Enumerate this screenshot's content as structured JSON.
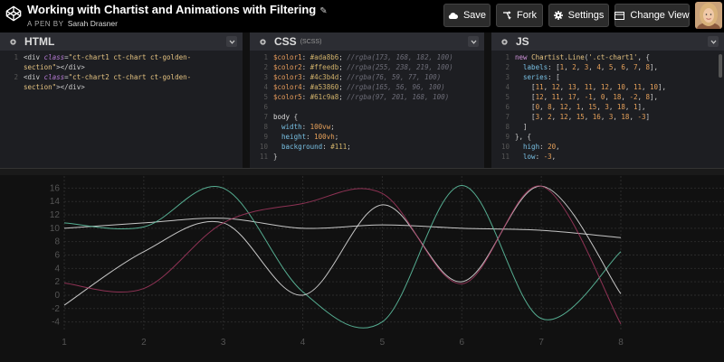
{
  "header": {
    "title": "Working with Chartist and Animations with Filtering",
    "pen_label": "A PEN BY",
    "author": "Sarah Drasner",
    "buttons": {
      "save": "Save",
      "fork": "Fork",
      "settings": "Settings",
      "change_view": "Change View"
    }
  },
  "panels": {
    "html": {
      "name": "HTML",
      "lines": [
        {
          "n": "1",
          "parts": [
            [
              "t-tag",
              "<div "
            ],
            [
              "t-attr",
              "class"
            ],
            [
              "t-tag",
              "="
            ],
            [
              "t-str",
              "\"ct-chart1 ct-chart ct-golden-"
            ]
          ]
        },
        {
          "n": "",
          "parts": [
            [
              "t-str",
              "section\""
            ],
            [
              "t-tag",
              "></div>"
            ]
          ]
        },
        {
          "n": "2",
          "parts": [
            [
              "t-tag",
              "<div "
            ],
            [
              "t-attr",
              "class"
            ],
            [
              "t-tag",
              "="
            ],
            [
              "t-str",
              "\"ct-chart2 ct-chart ct-golden-"
            ]
          ]
        },
        {
          "n": "",
          "parts": [
            [
              "t-str",
              "section\""
            ],
            [
              "t-tag",
              "></div>"
            ]
          ]
        }
      ]
    },
    "css": {
      "name": "CSS",
      "sub": "(SCSS)",
      "lines": [
        {
          "n": "1",
          "parts": [
            [
              "t-var",
              "$color1"
            ],
            [
              "t-plain",
              ": "
            ],
            [
              "t-val",
              "#ada8b6"
            ],
            [
              "t-plain",
              "; "
            ],
            [
              "t-com",
              "//rgba(173, 168, 182, 100)"
            ]
          ]
        },
        {
          "n": "2",
          "parts": [
            [
              "t-var",
              "$color2"
            ],
            [
              "t-plain",
              ": "
            ],
            [
              "t-val",
              "#ffeedb"
            ],
            [
              "t-plain",
              "; "
            ],
            [
              "t-com",
              "//rgba(255, 238, 219, 100)"
            ]
          ]
        },
        {
          "n": "3",
          "parts": [
            [
              "t-var",
              "$color3"
            ],
            [
              "t-plain",
              ": "
            ],
            [
              "t-val",
              "#4c3b4d"
            ],
            [
              "t-plain",
              "; "
            ],
            [
              "t-com",
              "//rgba(76, 59, 77, 100)"
            ]
          ]
        },
        {
          "n": "4",
          "parts": [
            [
              "t-var",
              "$color4"
            ],
            [
              "t-plain",
              ": "
            ],
            [
              "t-val",
              "#a53860"
            ],
            [
              "t-plain",
              "; "
            ],
            [
              "t-com",
              "//rgba(165, 56, 96, 100)"
            ]
          ]
        },
        {
          "n": "5",
          "parts": [
            [
              "t-var",
              "$color5"
            ],
            [
              "t-plain",
              ": "
            ],
            [
              "t-val",
              "#61c9a8"
            ],
            [
              "t-plain",
              "; "
            ],
            [
              "t-com",
              "//rgba(97, 201, 168, 100)"
            ]
          ]
        },
        {
          "n": "6",
          "parts": [
            [
              "t-plain",
              ""
            ]
          ]
        },
        {
          "n": "7",
          "parts": [
            [
              "t-sel",
              "body"
            ],
            [
              "t-plain",
              " {"
            ]
          ]
        },
        {
          "n": "8",
          "parts": [
            [
              "t-plain",
              "  "
            ],
            [
              "t-prop",
              "width"
            ],
            [
              "t-plain",
              ": "
            ],
            [
              "t-num",
              "100vw"
            ],
            [
              "t-plain",
              ";"
            ]
          ]
        },
        {
          "n": "9",
          "parts": [
            [
              "t-plain",
              "  "
            ],
            [
              "t-prop",
              "height"
            ],
            [
              "t-plain",
              ": "
            ],
            [
              "t-num",
              "100vh"
            ],
            [
              "t-plain",
              ";"
            ]
          ]
        },
        {
          "n": "10",
          "parts": [
            [
              "t-plain",
              "  "
            ],
            [
              "t-prop",
              "background"
            ],
            [
              "t-plain",
              ": "
            ],
            [
              "t-val",
              "#111"
            ],
            [
              "t-plain",
              ";"
            ]
          ]
        },
        {
          "n": "11",
          "parts": [
            [
              "t-plain",
              "}"
            ]
          ]
        }
      ]
    },
    "js": {
      "name": "JS",
      "lines": [
        {
          "n": "1",
          "parts": [
            [
              "t-kw",
              "new "
            ],
            [
              "t-fn",
              "Chartist"
            ],
            [
              "t-plain",
              "."
            ],
            [
              "t-fn",
              "Line"
            ],
            [
              "t-plain",
              "("
            ],
            [
              "t-str",
              "'.ct-chart1'"
            ],
            [
              "t-plain",
              ", {"
            ]
          ]
        },
        {
          "n": "2",
          "parts": [
            [
              "t-plain",
              "  "
            ],
            [
              "t-prop",
              "labels"
            ],
            [
              "t-plain",
              ": ["
            ],
            [
              "t-num",
              "1"
            ],
            [
              "t-plain",
              ", "
            ],
            [
              "t-num",
              "2"
            ],
            [
              "t-plain",
              ", "
            ],
            [
              "t-num",
              "3"
            ],
            [
              "t-plain",
              ", "
            ],
            [
              "t-num",
              "4"
            ],
            [
              "t-plain",
              ", "
            ],
            [
              "t-num",
              "5"
            ],
            [
              "t-plain",
              ", "
            ],
            [
              "t-num",
              "6"
            ],
            [
              "t-plain",
              ", "
            ],
            [
              "t-num",
              "7"
            ],
            [
              "t-plain",
              ", "
            ],
            [
              "t-num",
              "8"
            ],
            [
              "t-plain",
              "],"
            ]
          ]
        },
        {
          "n": "3",
          "parts": [
            [
              "t-plain",
              "  "
            ],
            [
              "t-prop",
              "series"
            ],
            [
              "t-plain",
              ": ["
            ]
          ]
        },
        {
          "n": "4",
          "parts": [
            [
              "t-plain",
              "    ["
            ],
            [
              "t-num",
              "11"
            ],
            [
              "t-plain",
              ", "
            ],
            [
              "t-num",
              "12"
            ],
            [
              "t-plain",
              ", "
            ],
            [
              "t-num",
              "13"
            ],
            [
              "t-plain",
              ", "
            ],
            [
              "t-num",
              "11"
            ],
            [
              "t-plain",
              ", "
            ],
            [
              "t-num",
              "12"
            ],
            [
              "t-plain",
              ", "
            ],
            [
              "t-num",
              "10"
            ],
            [
              "t-plain",
              ", "
            ],
            [
              "t-num",
              "11"
            ],
            [
              "t-plain",
              ", "
            ],
            [
              "t-num",
              "10"
            ],
            [
              "t-plain",
              "],"
            ]
          ]
        },
        {
          "n": "5",
          "parts": [
            [
              "t-plain",
              "    ["
            ],
            [
              "t-num",
              "12"
            ],
            [
              "t-plain",
              ", "
            ],
            [
              "t-num",
              "11"
            ],
            [
              "t-plain",
              ", "
            ],
            [
              "t-num",
              "17"
            ],
            [
              "t-plain",
              ", "
            ],
            [
              "t-num",
              "-1"
            ],
            [
              "t-plain",
              ", "
            ],
            [
              "t-num",
              "0"
            ],
            [
              "t-plain",
              ", "
            ],
            [
              "t-num",
              "18"
            ],
            [
              "t-plain",
              ", "
            ],
            [
              "t-num",
              "-2"
            ],
            [
              "t-plain",
              ", "
            ],
            [
              "t-num",
              "8"
            ],
            [
              "t-plain",
              "],"
            ]
          ]
        },
        {
          "n": "6",
          "parts": [
            [
              "t-plain",
              "    ["
            ],
            [
              "t-num",
              "0"
            ],
            [
              "t-plain",
              ", "
            ],
            [
              "t-num",
              "8"
            ],
            [
              "t-plain",
              ", "
            ],
            [
              "t-num",
              "12"
            ],
            [
              "t-plain",
              ", "
            ],
            [
              "t-num",
              "1"
            ],
            [
              "t-plain",
              ", "
            ],
            [
              "t-num",
              "15"
            ],
            [
              "t-plain",
              ", "
            ],
            [
              "t-num",
              "3"
            ],
            [
              "t-plain",
              ", "
            ],
            [
              "t-num",
              "18"
            ],
            [
              "t-plain",
              ", "
            ],
            [
              "t-num",
              "1"
            ],
            [
              "t-plain",
              "],"
            ]
          ]
        },
        {
          "n": "7",
          "parts": [
            [
              "t-plain",
              "    ["
            ],
            [
              "t-num",
              "3"
            ],
            [
              "t-plain",
              ", "
            ],
            [
              "t-num",
              "2"
            ],
            [
              "t-plain",
              ", "
            ],
            [
              "t-num",
              "12"
            ],
            [
              "t-plain",
              ", "
            ],
            [
              "t-num",
              "15"
            ],
            [
              "t-plain",
              ", "
            ],
            [
              "t-num",
              "16"
            ],
            [
              "t-plain",
              ", "
            ],
            [
              "t-num",
              "3"
            ],
            [
              "t-plain",
              ", "
            ],
            [
              "t-num",
              "18"
            ],
            [
              "t-plain",
              ", "
            ],
            [
              "t-num",
              "-3"
            ],
            [
              "t-plain",
              "]"
            ]
          ]
        },
        {
          "n": "8",
          "parts": [
            [
              "t-plain",
              "  ]"
            ]
          ]
        },
        {
          "n": "9",
          "parts": [
            [
              "t-plain",
              "}, {"
            ]
          ]
        },
        {
          "n": "10",
          "parts": [
            [
              "t-plain",
              "  "
            ],
            [
              "t-prop",
              "high"
            ],
            [
              "t-plain",
              ": "
            ],
            [
              "t-num",
              "20"
            ],
            [
              "t-plain",
              ","
            ]
          ]
        },
        {
          "n": "11",
          "parts": [
            [
              "t-plain",
              "  "
            ],
            [
              "t-prop",
              "low"
            ],
            [
              "t-plain",
              ": "
            ],
            [
              "t-num",
              "-3"
            ],
            [
              "t-plain",
              ","
            ]
          ]
        }
      ]
    }
  },
  "colors": {
    "white_line": "#e6e6e6",
    "green_line": "#61c9a8",
    "pink_line": "#a53860",
    "grid": "#2a2a2a",
    "axis_label": "#555555"
  },
  "chart_data": {
    "type": "line",
    "x": [
      1,
      2,
      3,
      4,
      5,
      6,
      7,
      8
    ],
    "xticks": [
      "1",
      "2",
      "3",
      "4",
      "5",
      "6",
      "7",
      "8"
    ],
    "yticks": [
      "-4",
      "-2",
      "0",
      "2",
      "4",
      "6",
      "8",
      "10",
      "12",
      "14",
      "16"
    ],
    "ylim": [
      -5,
      17
    ],
    "grid": true,
    "series": [
      {
        "color": "#e6e6e6",
        "values": [
          10,
          10.8,
          11.5,
          10,
          10.5,
          10,
          9.7,
          8.6
        ]
      },
      {
        "color": "#61c9a8",
        "values": [
          10.8,
          10.2,
          16,
          0.5,
          -4,
          16.4,
          -3.5,
          6.5
        ]
      },
      {
        "color": "#e6e6e6",
        "values": [
          -1.5,
          6.5,
          10.8,
          0,
          13.5,
          2,
          16.3,
          0.2
        ]
      },
      {
        "color": "#a53860",
        "values": [
          1.8,
          1,
          10.8,
          13.7,
          15.2,
          1.7,
          16.3,
          -4.3
        ]
      }
    ]
  }
}
